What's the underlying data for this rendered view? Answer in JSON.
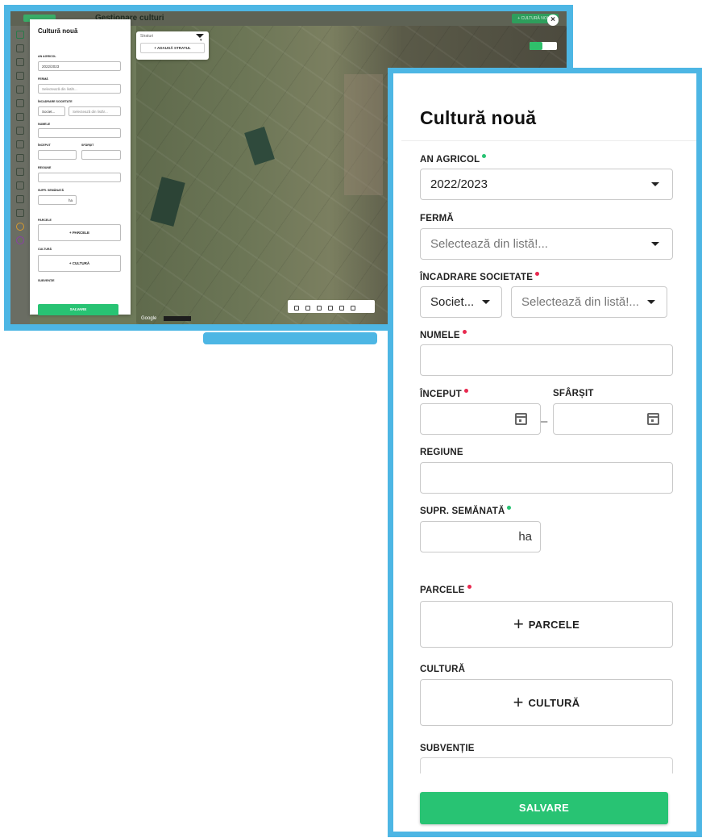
{
  "mini": {
    "page_title": "Gestionare culturi",
    "new_button": "+ CULTURĂ NOUĂ",
    "close_icon": "×",
    "form": {
      "title": "Cultură nouă",
      "an_agricol_label": "AN AGRICOL",
      "an_agricol_value": "2022/2023",
      "ferma_label": "FERMĂ",
      "ferma_placeholder": "Selectează din listă!...",
      "incadrare_label": "ÎNCADRARE SOCIETATE",
      "societ_value": "Societ...",
      "societ_placeholder": "Selectează din listă!...",
      "numele_label": "NUMELE",
      "inceput_label": "ÎNCEPUT",
      "sfarsit_label": "SFÂRȘIT",
      "regiune_label": "REGIUNE",
      "supr_label": "SUPR. SEMĂNATĂ",
      "unit_ha": "ha",
      "parcele_label": "PARCELE",
      "parcele_button": "+ PARCELE",
      "cultura_label": "CULTURĂ",
      "cultura_button": "+ CULTURĂ",
      "subventie_label": "SUBVENȚIE",
      "save_button": "SALVARE"
    },
    "layers": {
      "label": "Straturi",
      "add_button": "+ ADAUGĂ STRATUL"
    },
    "map": {
      "google_label": "Google"
    }
  },
  "panel": {
    "title": "Cultură nouă",
    "an_agricol": {
      "label": "AN AGRICOL",
      "value": "2022/2023"
    },
    "ferma": {
      "label": "FERMĂ",
      "placeholder": "Selectează din listă!..."
    },
    "incadrare": {
      "label": "ÎNCADRARE SOCIETATE",
      "left_value": "Societ...",
      "right_placeholder": "Selectează din listă!..."
    },
    "numele": {
      "label": "NUMELE"
    },
    "inceput": {
      "label": "ÎNCEPUT"
    },
    "sfarsit": {
      "label": "SFÂRȘIT"
    },
    "regiune": {
      "label": "REGIUNE"
    },
    "supr": {
      "label": "SUPR. SEMĂNATĂ",
      "unit": "ha"
    },
    "parcele": {
      "label": "PARCELE",
      "button": "PARCELE"
    },
    "cultura": {
      "label": "CULTURĂ",
      "button": "CULTURĂ"
    },
    "subventie": {
      "label": "SUBVENȚIE"
    },
    "save_button": "SALVARE"
  },
  "colors": {
    "accent_green": "#28c373",
    "required_red": "#e8294f",
    "frame_blue": "#4db6e4"
  }
}
